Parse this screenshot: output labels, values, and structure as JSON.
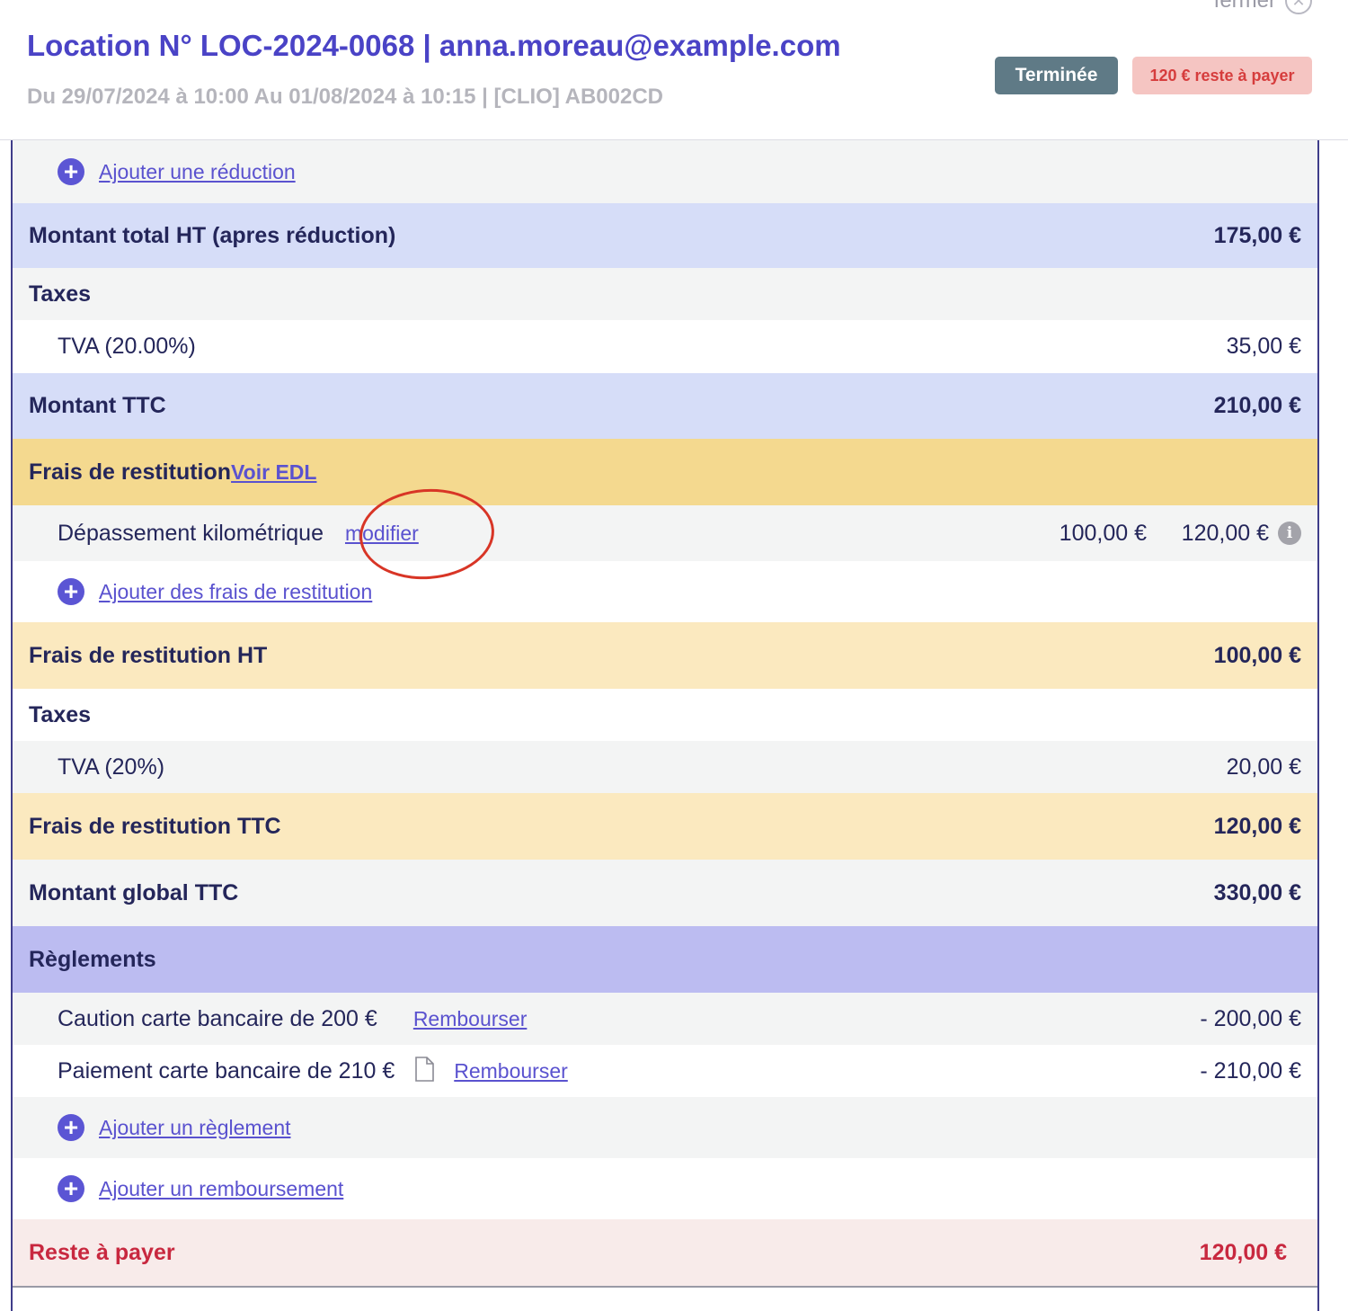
{
  "header": {
    "close_label": "fermer",
    "title": "Location N° LOC-2024-0068 | anna.moreau@example.com",
    "subtitle": "Du 29/07/2024 à 10:00 Au 01/08/2024 à 10:15 | [CLIO] AB002CD",
    "status_badge": "Terminée",
    "due_badge": "120 € reste à payer"
  },
  "rows": {
    "add_discount": "Ajouter une réduction",
    "total_ht_label": "Montant total HT (apres réduction)",
    "total_ht_value": "175,00 €",
    "taxes_label": "Taxes",
    "tva_label": "TVA (20.00%)",
    "tva_value": "35,00 €",
    "ttc_label": "Montant TTC",
    "ttc_value": "210,00 €",
    "return_fees_label": "Frais de restitution",
    "view_edl_link": " Voir EDL",
    "km_label": "Dépassement kilométrique",
    "km_modify_link": "modifier",
    "km_ht_value": "100,00 €",
    "km_ttc_value": "120,00 €",
    "add_return_fees": "Ajouter des frais de restitution",
    "return_ht_label": "Frais de restitution HT",
    "return_ht_value": "100,00 €",
    "return_taxes_label": "Taxes",
    "return_tva_label": "TVA (20%)",
    "return_tva_value": "20,00 €",
    "return_ttc_label": "Frais de restitution TTC",
    "return_ttc_value": "120,00 €",
    "global_ttc_label": "Montant global TTC",
    "global_ttc_value": "330,00 €",
    "payments_label": "Règlements",
    "deposit_label": "Caution carte bancaire de 200 €",
    "deposit_refund_link": "Rembourser",
    "deposit_value": "- 200,00 €",
    "payment_label": "Paiement carte bancaire de 210 €",
    "payment_refund_link": "Rembourser",
    "payment_value": "- 210,00 €",
    "add_payment": "Ajouter un règlement",
    "add_refund": "Ajouter un remboursement",
    "remaining_label": "Reste à payer",
    "remaining_value": "120,00 €"
  },
  "icons": {
    "close": "close-icon",
    "plus": "plus-circle-icon",
    "info": "info-icon",
    "document": "document-icon"
  },
  "colors": {
    "brand": "#4a43c6",
    "status_badge_bg": "#5f7a86",
    "due_badge_bg": "#f5c5c2",
    "due_text": "#d63d3d",
    "remaining_text": "#c8283f",
    "annotation_circle": "#d83526"
  }
}
